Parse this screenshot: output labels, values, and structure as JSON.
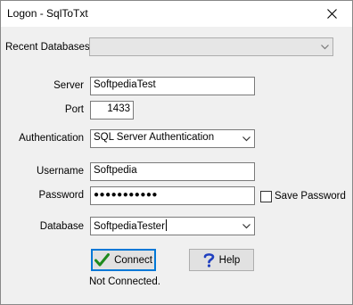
{
  "window": {
    "title": "Logon - SqlToTxt"
  },
  "form": {
    "recent_label": "Recent Databases",
    "recent_value": "",
    "server_label": "Server",
    "server_value": "SoftpediaTest",
    "port_label": "Port",
    "port_value": "1433",
    "auth_label": "Authentication",
    "auth_value": "SQL Server Authentication",
    "username_label": "Username",
    "username_value": "Softpedia",
    "password_label": "Password",
    "password_value": "●●●●●●●●●●●",
    "save_password_label": "Save Password",
    "database_label": "Database",
    "database_value": "SoftpediaTester"
  },
  "buttons": {
    "connect": "Connect",
    "help": "Help"
  },
  "status_text": "Not Connected.",
  "icons": {
    "close": "close-icon",
    "connect": "checkmark-icon",
    "help": "question-icon",
    "dropdown": "chevron-down-icon"
  },
  "colors": {
    "accent": "#0078d7",
    "check_green": "#1e8a1e",
    "help_blue": "#1f3fbf"
  }
}
